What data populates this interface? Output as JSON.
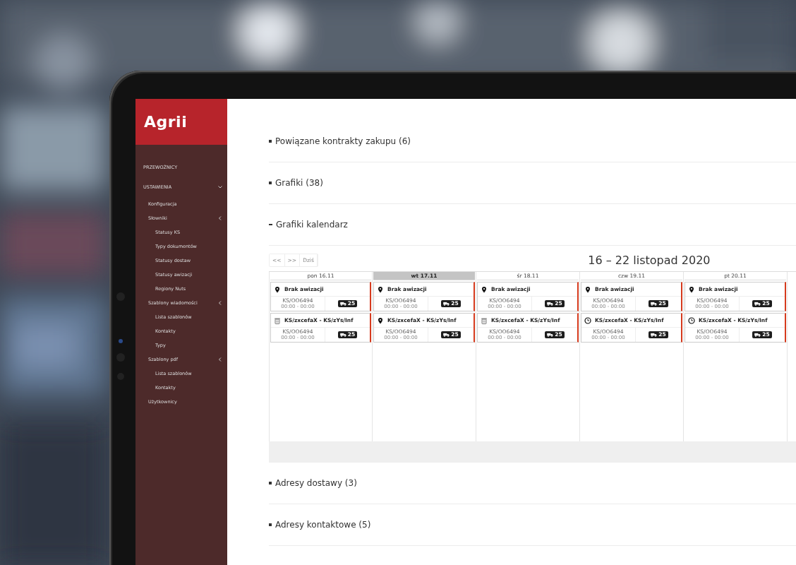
{
  "sidebar": {
    "logo": "Agrii",
    "items": [
      {
        "label": "PRZEWOŹNICY"
      },
      {
        "label": "USTAWIENIA",
        "kind": "down",
        "children": [
          {
            "label": "Konfiguracja"
          },
          {
            "label": "Słowniki",
            "kind": "left",
            "children": [
              {
                "label": "Statusy KS"
              },
              {
                "label": "Typy dokumentów"
              },
              {
                "label": "Statusy dostaw"
              },
              {
                "label": "Statusy awizacji"
              },
              {
                "label": "Regiony Nuts"
              }
            ]
          },
          {
            "label": "Szablony wiadomości",
            "kind": "left",
            "children": [
              {
                "label": "Lista szablonów"
              },
              {
                "label": "Kontakty"
              },
              {
                "label": "Typy"
              }
            ]
          },
          {
            "label": "Szablony pdf",
            "kind": "left",
            "children": [
              {
                "label": "Lista szablonów"
              },
              {
                "label": "Kontakty"
              }
            ]
          },
          {
            "label": "Użytkownicy"
          }
        ]
      }
    ]
  },
  "sections_top": [
    {
      "title": "Powiązane kontrakty zakupu (6)",
      "expanded": false
    },
    {
      "title": "Grafiki (38)",
      "expanded": false
    },
    {
      "title": "Grafiki kalendarz",
      "expanded": true
    }
  ],
  "calendar": {
    "nav": [
      "<<",
      ">>",
      "Dziś"
    ],
    "title": "16 – 22 listopad 2020",
    "days": [
      {
        "label": "pon 16.11",
        "selected": false,
        "events": [
          {
            "kind": "pin",
            "title": "Brak awizacji",
            "code": "KS/OO6494",
            "time": "00:00 - 00:00",
            "badge": "25"
          },
          {
            "kind": "trash",
            "title": "KS/zxcefaX - KS/zYs/Inf",
            "code": "KS/OO6494",
            "time": "00:00 - 00:00",
            "badge": "25"
          }
        ]
      },
      {
        "label": "wt 17.11",
        "selected": true,
        "events": [
          {
            "kind": "pin",
            "title": "Brak awizacji",
            "code": "KS/OO6494",
            "time": "00:00 - 00:00",
            "badge": "25"
          },
          {
            "kind": "pin",
            "title": "KS/zxcefaX - KS/zYs/Inf",
            "code": "KS/OO6494",
            "time": "00:00 - 00:00",
            "badge": "25"
          }
        ]
      },
      {
        "label": "śr 18.11",
        "selected": false,
        "events": [
          {
            "kind": "pin",
            "title": "Brak awizacji",
            "code": "KS/OO6494",
            "time": "00:00 - 00:00",
            "badge": "25"
          },
          {
            "kind": "trash",
            "title": "KS/zxcefaX - KS/zYs/Inf",
            "code": "KS/OO6494",
            "time": "00:00 - 00:00",
            "badge": "25"
          }
        ]
      },
      {
        "label": "czw 19.11",
        "selected": false,
        "events": [
          {
            "kind": "pin",
            "title": "Brak awizacji",
            "code": "KS/OO6494",
            "time": "00:00 - 00:00",
            "badge": "25"
          },
          {
            "kind": "clock",
            "title": "KS/zxcefaX - KS/zYs/Inf",
            "code": "KS/OO6494",
            "time": "00:00 - 00:00",
            "badge": "25"
          }
        ]
      },
      {
        "label": "pt 20.11",
        "selected": false,
        "events": [
          {
            "kind": "pin",
            "title": "Brak awizacji",
            "code": "KS/OO6494",
            "time": "00:00 - 00:00",
            "badge": "25"
          },
          {
            "kind": "clock",
            "title": "KS/zxcefaX - KS/zYs/Inf",
            "code": "KS/OO6494",
            "time": "00:00 - 00:00",
            "badge": "25"
          }
        ]
      }
    ]
  },
  "sections_bottom": [
    {
      "title": "Adresy dostawy (3)",
      "expanded": false
    },
    {
      "title": "Adresy kontaktowe (5)",
      "expanded": false
    }
  ]
}
